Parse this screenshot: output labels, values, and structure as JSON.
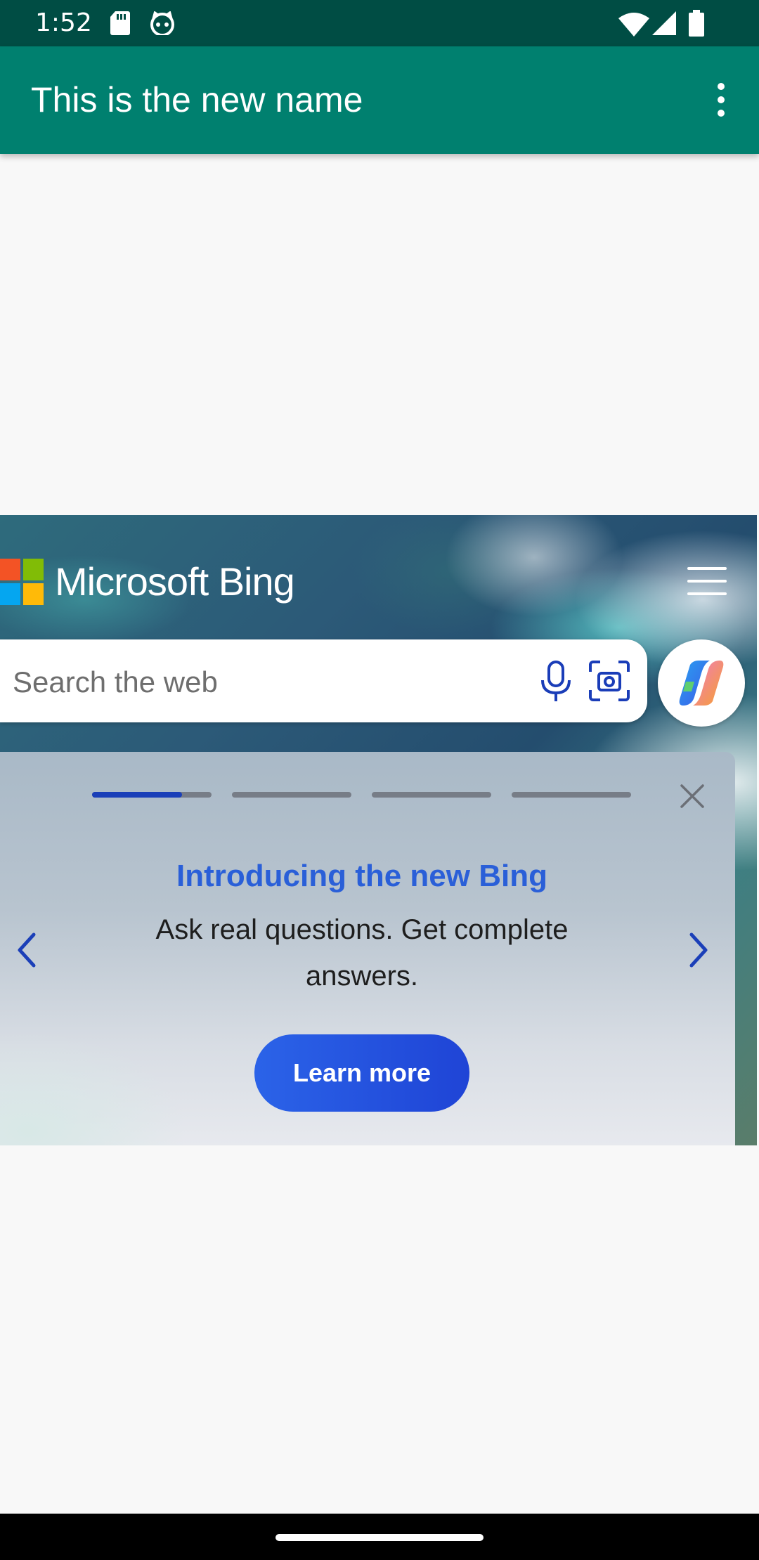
{
  "status_bar": {
    "time": "1:52",
    "icons": [
      "sd-card-icon",
      "cat-face-icon",
      "wifi-icon",
      "cell-signal-icon",
      "battery-icon"
    ]
  },
  "app_bar": {
    "title": "This is the new name",
    "overflow_icon": "more-vert-icon"
  },
  "web": {
    "brand": "Microsoft Bing",
    "brand_colors": [
      "#f35325",
      "#81bc06",
      "#05a6f0",
      "#ffba08"
    ],
    "search": {
      "placeholder": "Search the web",
      "value": ""
    },
    "promo": {
      "title": "Introducing the new Bing",
      "description": "Ask real questions. Get complete answers.",
      "cta_label": "Learn more",
      "steps_total": 4,
      "current_step": 1,
      "current_step_progress": 0.75
    }
  },
  "colors": {
    "status_bar": "#004d44",
    "app_bar": "#00806f",
    "promo_title": "#2a5fd8",
    "cta": "#2351e0"
  }
}
